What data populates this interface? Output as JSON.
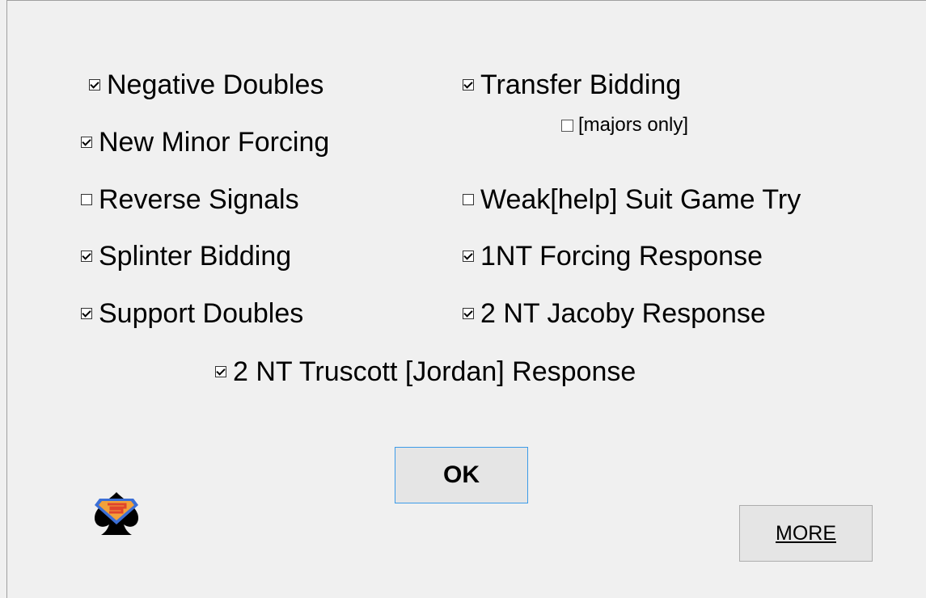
{
  "options": {
    "negative_doubles": {
      "label": "Negative Doubles",
      "checked": true
    },
    "transfer_bidding": {
      "label": "Transfer Bidding",
      "checked": true
    },
    "majors_only": {
      "label": "[majors only]",
      "checked": false
    },
    "new_minor_forcing": {
      "label": "New Minor Forcing",
      "checked": true
    },
    "reverse_signals": {
      "label": "Reverse Signals",
      "checked": false
    },
    "weak_help_suit_game_try": {
      "label": "Weak[help] Suit Game Try",
      "checked": false
    },
    "splinter_bidding": {
      "label": "Splinter Bidding",
      "checked": true
    },
    "one_nt_forcing_response": {
      "label": "1NT Forcing Response",
      "checked": true
    },
    "support_doubles": {
      "label": "Support Doubles",
      "checked": true
    },
    "two_nt_jacoby_response": {
      "label": "2 NT Jacoby Response",
      "checked": true
    },
    "two_nt_truscott_response": {
      "label": "2 NT Truscott [Jordan] Response",
      "checked": true
    }
  },
  "buttons": {
    "ok_label": "OK",
    "more_label": "MORE"
  },
  "colors": {
    "background": "#f0f0f0",
    "ok_focus_border": "#3c9be8",
    "logo_shield": "#3b6fd6",
    "logo_fill": "#f2a13a",
    "logo_emblem": "#e0452c"
  },
  "logo": {
    "icon": "superman-spade-icon"
  }
}
